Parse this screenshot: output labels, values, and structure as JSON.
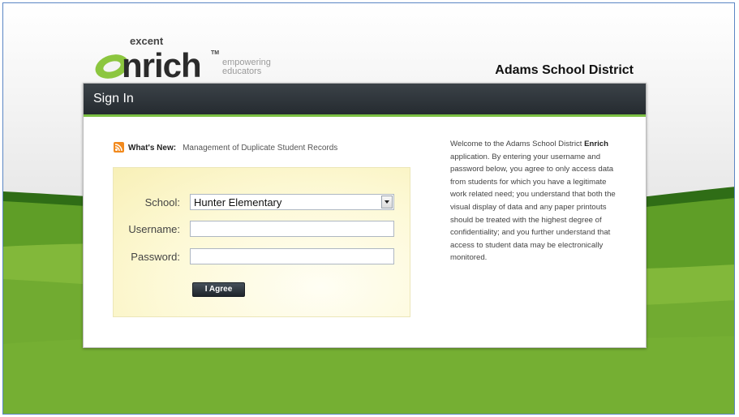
{
  "brand": {
    "prefix": "excent",
    "name": "enrich",
    "trademark": "TM",
    "tagline_line1": "empowering",
    "tagline_line2": "educators"
  },
  "header": {
    "district": "Adams School District"
  },
  "panel": {
    "title": "Sign In"
  },
  "whats_new": {
    "label": "What's New:",
    "link": "Management of Duplicate Student Records"
  },
  "form": {
    "school_label": "School:",
    "school_value": "Hunter Elementary",
    "username_label": "Username:",
    "username_value": "",
    "password_label": "Password:",
    "password_value": "",
    "submit_label": "I Agree"
  },
  "notice": {
    "part1": "Welcome to the Adams School District ",
    "app_name": "Enrich",
    "part2": " application. By entering your username and password below, you agree to only access data from students for which you have a legitimate work related need; you understand that both the visual display of data and any paper printouts should be treated with the highest degree of confidentiality; and you further understand that access to student data may be electronically monitored."
  },
  "colors": {
    "accent_green": "#7cc043",
    "header_dark": "#2c3237",
    "frame_border": "#5b86c4"
  },
  "icons": {
    "rss": "rss-icon",
    "select_arrow": "chevron-down-icon"
  }
}
